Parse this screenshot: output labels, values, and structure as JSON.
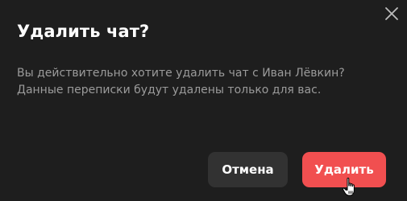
{
  "dialog": {
    "title": "Удалить чат?",
    "message_line1": "Вы действительно хотите удалить чат с Иван Лёвкин?",
    "message_line2": "Данные переписки будут удалены только для вас.",
    "cancel_label": "Отмена",
    "delete_label": "Удалить",
    "close_icon": "close-icon",
    "cursor_icon": "hand-pointer-icon"
  },
  "colors": {
    "background": "#1e1e1e",
    "text_primary": "#ffffff",
    "text_secondary": "#9b9b9b",
    "cancel_bg": "#323232",
    "delete_bg": "#f14f50"
  }
}
